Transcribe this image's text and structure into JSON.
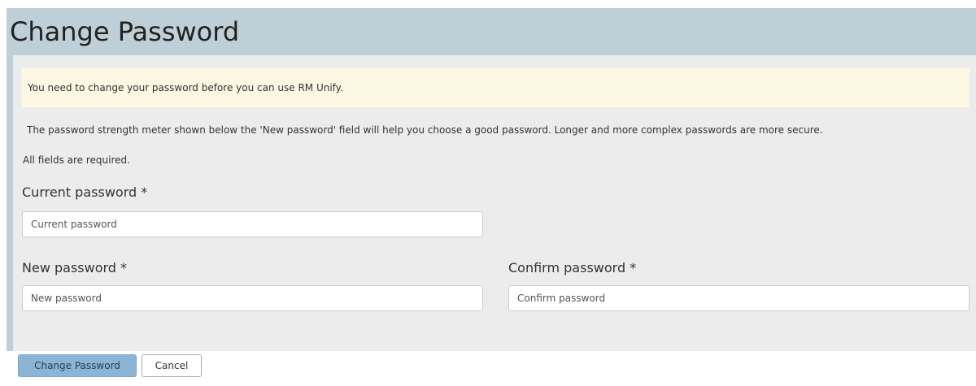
{
  "header": {
    "title": "Change Password"
  },
  "notice": {
    "text": "You need to change your password before you can use RM Unify."
  },
  "info": {
    "text": "The password strength meter shown below the 'New password' field will help you choose a good password. Longer and more complex passwords are more secure."
  },
  "required_note": "All fields are required.",
  "fields": {
    "current": {
      "label": "Current password *",
      "placeholder": "Current password",
      "value": ""
    },
    "new": {
      "label": "New password *",
      "placeholder": "New password",
      "value": ""
    },
    "confirm": {
      "label": "Confirm password *",
      "placeholder": "Confirm password",
      "value": ""
    }
  },
  "actions": {
    "submit_label": "Change Password",
    "cancel_label": "Cancel"
  },
  "colors": {
    "header_background": "#bfcfd7",
    "panel_background": "#ececec",
    "notice_background": "#fcf7e3",
    "primary_button": "#8cb4d5"
  }
}
